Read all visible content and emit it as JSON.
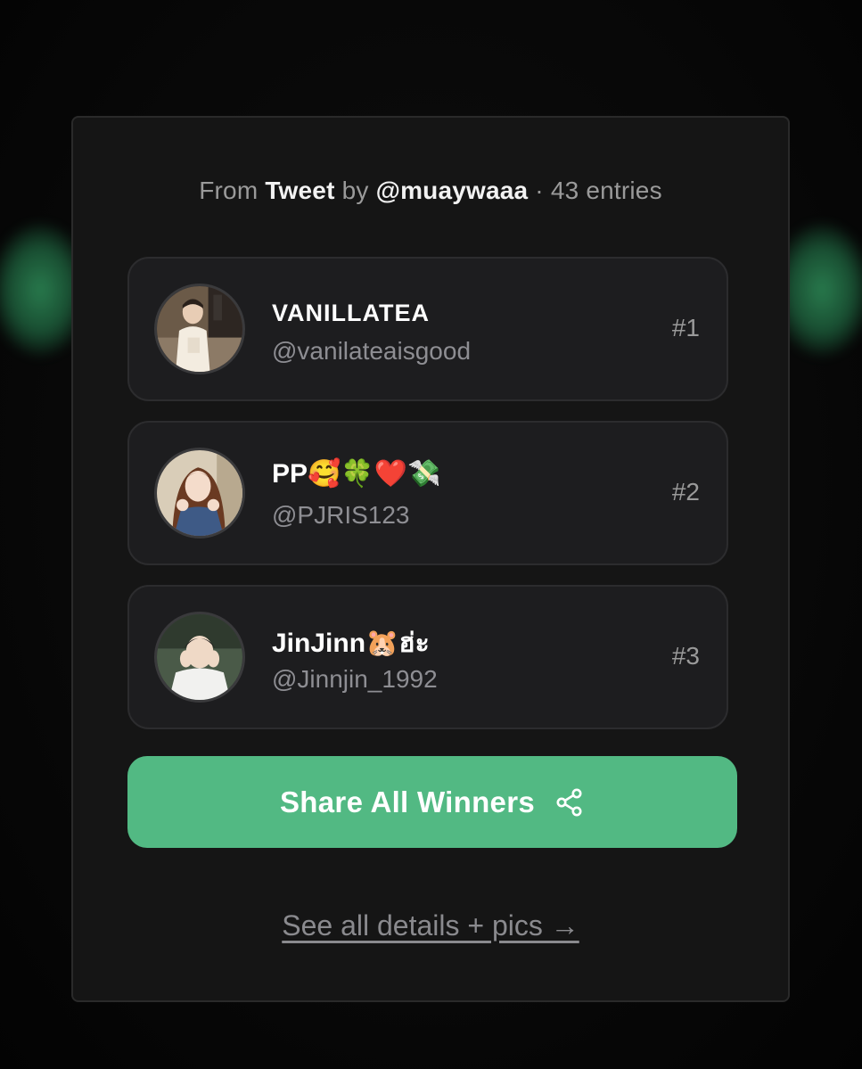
{
  "header": {
    "from_label": "From",
    "source": "Tweet",
    "by_label": "by",
    "author": "@muaywaaa",
    "separator": "·",
    "entries": "43 entries"
  },
  "winners": [
    {
      "name": "VANILLATEA",
      "handle": "@vanilateaisgood",
      "rank": "#1"
    },
    {
      "name": "PP🥰🍀❤️💸",
      "handle": "@PJRIS123",
      "rank": "#2"
    },
    {
      "name": "JinJinn🐹ฮ่ะ",
      "handle": "@Jinnjin_1992",
      "rank": "#3"
    }
  ],
  "actions": {
    "share_label": "Share All Winners",
    "details_link": "See all details + pics →"
  },
  "colors": {
    "accent": "#52b983",
    "card_bg": "#151515",
    "row_bg": "#1d1d1f"
  },
  "icons": {
    "share": "share-icon"
  }
}
